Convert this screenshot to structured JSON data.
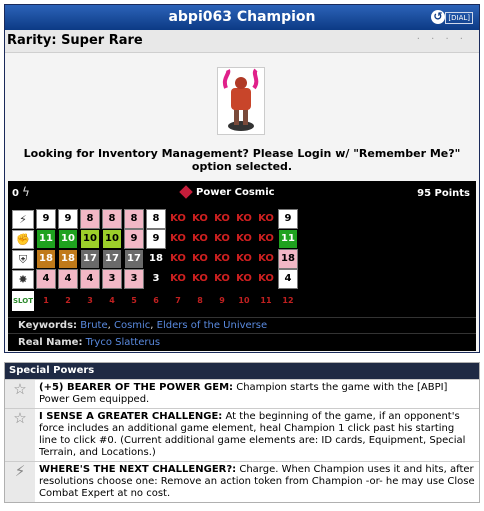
{
  "header": {
    "title": "abpi063 Champion",
    "undo_icon": "undo-icon",
    "dial_label": "[DIAL]"
  },
  "rarity": {
    "label": "Rarity: Super Rare",
    "dots": "· · · ·"
  },
  "login_message": "Looking for Inventory Management? Please Login w/ \"Remember Me?\" option selected.",
  "dial": {
    "zero": "0",
    "power_name": "Power Cosmic",
    "points": "95 Points",
    "stat_icons": [
      "boot-icon",
      "fist-icon",
      "shield-icon",
      "starburst-icon"
    ],
    "slot_label": "SLOT",
    "rows": [
      [
        "9",
        "9",
        "8",
        "8",
        "8",
        "8",
        "KO",
        "KO",
        "KO",
        "KO",
        "KO",
        "9"
      ],
      [
        "11",
        "10",
        "10",
        "10",
        "9",
        "9",
        "KO",
        "KO",
        "KO",
        "KO",
        "KO",
        "11"
      ],
      [
        "18",
        "18",
        "17",
        "17",
        "17",
        "18",
        "KO",
        "KO",
        "KO",
        "KO",
        "KO",
        "18"
      ],
      [
        "4",
        "4",
        "4",
        "3",
        "3",
        "3",
        "KO",
        "KO",
        "KO",
        "KO",
        "KO",
        "4"
      ]
    ],
    "slot_numbers": [
      "1",
      "2",
      "3",
      "4",
      "5",
      "6",
      "7",
      "8",
      "9",
      "10",
      "11",
      "12"
    ],
    "colors": {
      "row0": [
        "#ffffff",
        "#ffffff",
        "#f2b8c6",
        "#f2b8c6",
        "#f2b8c6",
        "#ffffff",
        "#000000",
        "#000000",
        "#000000",
        "#000000",
        "#000000",
        "#ffffff"
      ],
      "row1": [
        "#1fa21f",
        "#1fa21f",
        "#9ccf2a",
        "#9ccf2a",
        "#f2b8c6",
        "#ffffff",
        "#000000",
        "#000000",
        "#000000",
        "#000000",
        "#000000",
        "#1fa21f"
      ],
      "row2": [
        "#c07a1a",
        "#c07a1a",
        "#6a6a6a",
        "#6a6a6a",
        "#6a6a6a",
        "#000000",
        "#000000",
        "#000000",
        "#000000",
        "#000000",
        "#000000",
        "#f2b8c6"
      ],
      "row3": [
        "#f2b8c6",
        "#f2b8c6",
        "#f2b8c6",
        "#f2b8c6",
        "#f2b8c6",
        "#000000",
        "#000000",
        "#000000",
        "#000000",
        "#000000",
        "#000000",
        "#ffffff"
      ]
    },
    "keywords_label": "Keywords:",
    "keywords": [
      "Brute",
      "Cosmic",
      "Elders of the Universe"
    ],
    "real_name_label": "Real Name:",
    "real_name": "Tryco Slatterus"
  },
  "powers": {
    "header": "Special Powers",
    "items": [
      {
        "icon": "star-icon",
        "title": "(+5) BEARER OF THE POWER GEM:",
        "text": " Champion starts the game with the [ABPI] Power Gem equipped."
      },
      {
        "icon": "star-icon",
        "title": "I SENSE A GREATER CHALLENGE:",
        "text": " At the beginning of the game, if an opponent's force includes an additional game element, heal Champion 1 click past his starting line to click #0. (Current additional game elements are: ID cards, Equipment, Special Terrain, and Locations.)"
      },
      {
        "icon": "boot-icon",
        "title": "WHERE'S THE NEXT CHALLENGER?:",
        "text": " Charge. When Champion uses it and hits, after resolutions choose one: Remove an action token from Champion -or- he may use Close Combat Expert at no cost."
      }
    ]
  }
}
